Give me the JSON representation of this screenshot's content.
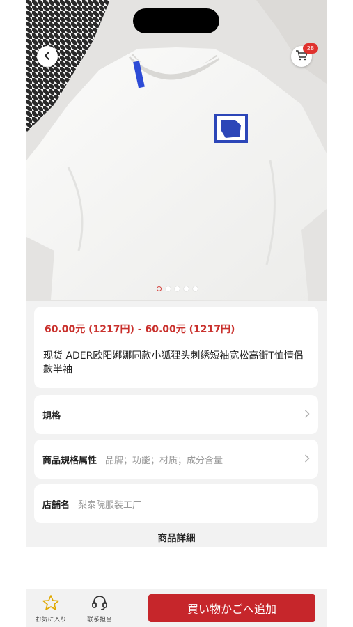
{
  "header": {
    "back_icon": "chevron-left-icon",
    "cart_icon": "cart-icon",
    "cart_badge": "28"
  },
  "gallery": {
    "image_count": 5,
    "active_index": 0
  },
  "product": {
    "price": "60.00元 (1217円) - 60.00元 (1217円)",
    "title": "现货 ADER欧阳娜娜同款小狐狸头刺绣短袖宽松高街T恤情侣款半袖"
  },
  "rows": {
    "spec_label": "規格",
    "attr_label": "商品規格属性",
    "attr_value": "品牌；功能；材质；成分含量",
    "shop_label": "店舗名",
    "shop_value": "梨泰院服装工厂"
  },
  "details": {
    "title": "商品詳細"
  },
  "bottom_bar": {
    "favorite_label": "お気に入り",
    "contact_label": "联系担当",
    "add_to_cart_label": "買い物かごへ追加"
  },
  "colors": {
    "accent": "#c6262b",
    "price": "#c9302c",
    "badge": "#e0322e"
  }
}
